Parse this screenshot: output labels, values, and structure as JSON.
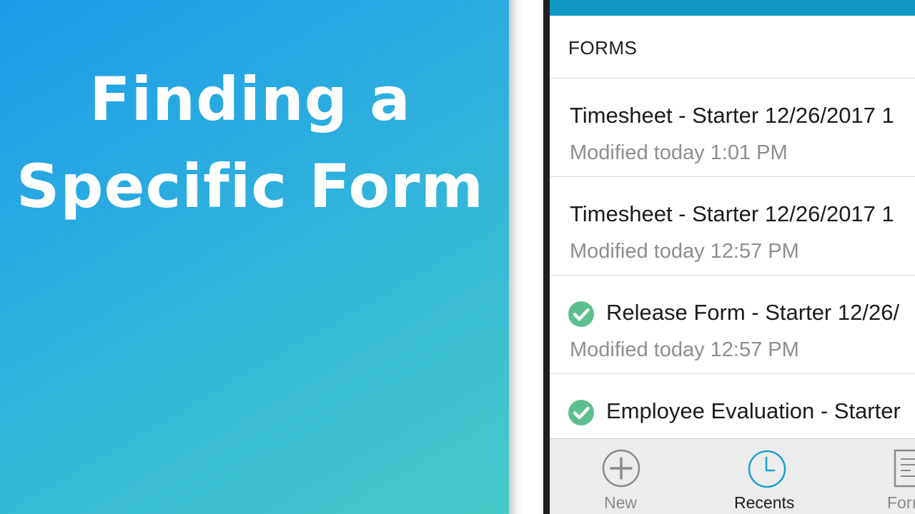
{
  "promo": {
    "title_line1": "Finding a",
    "title_line2": "Specific Form"
  },
  "colors": {
    "gradient_start": "#1c9ce8",
    "gradient_end": "#46cbc9",
    "topbar": "#1197c4",
    "check_green": "#5cbf8f",
    "recents_accent": "#1a9fd0"
  },
  "header": {
    "label": "FORMS"
  },
  "list": [
    {
      "title": "Timesheet - Starter 12/26/2017 1",
      "subtitle": "Modified today 1:01 PM",
      "completed": false
    },
    {
      "title": "Timesheet - Starter 12/26/2017 1",
      "subtitle": "Modified today 12:57 PM",
      "completed": false
    },
    {
      "title": "Release Form - Starter 12/26/",
      "subtitle": "Modified today 12:57 PM",
      "completed": true,
      "icon": "check-circle-icon"
    },
    {
      "title": "Employee Evaluation - Starter",
      "subtitle": "",
      "completed": true,
      "icon": "check-circle-icon"
    }
  ],
  "tabs": {
    "new": {
      "label": "New",
      "icon": "plus-circle-icon"
    },
    "recents": {
      "label": "Recents",
      "icon": "clock-icon",
      "active": true
    },
    "forms": {
      "label": "Forı",
      "icon": "document-icon"
    }
  }
}
